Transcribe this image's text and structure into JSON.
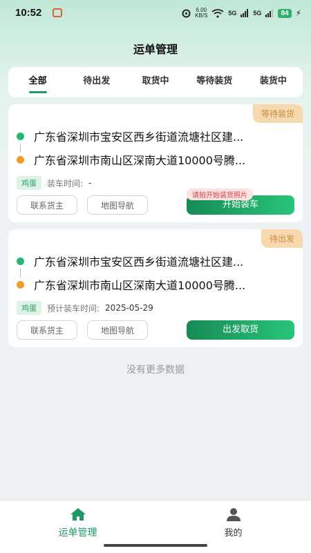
{
  "status_bar": {
    "time": "10:52",
    "speed_value": "6.00",
    "speed_unit": "KB/S",
    "network_1": "5G",
    "network_2": "5G",
    "battery": "84"
  },
  "page_title": "运单管理",
  "tabs": [
    {
      "label": "全部",
      "active": true
    },
    {
      "label": "待出发",
      "active": false
    },
    {
      "label": "取货中",
      "active": false
    },
    {
      "label": "等待装货",
      "active": false
    },
    {
      "label": "装货中",
      "active": false
    }
  ],
  "orders": [
    {
      "status": "等待装货",
      "from": "广东省深圳市宝安区西乡街道流塘社区建...",
      "to": "广东省深圳市南山区深南大道10000号腾...",
      "tag": "鸡蛋",
      "time_label": "装车时间:",
      "time_value": "-",
      "btn_contact": "联系货主",
      "btn_nav": "地图导航",
      "tip": "请拍开始装货照片",
      "btn_primary": "开始装车"
    },
    {
      "status": "待出发",
      "from": "广东省深圳市宝安区西乡街道流塘社区建...",
      "to": "广东省深圳市南山区深南大道10000号腾...",
      "tag": "鸡蛋",
      "time_label": "预计装车时间:",
      "time_value": "2025-05-29",
      "btn_contact": "联系货主",
      "btn_nav": "地图导航",
      "btn_primary": "出发取货"
    }
  ],
  "no_more_text": "没有更多数据",
  "bottom_nav": [
    {
      "label": "运单管理",
      "icon": "home-icon",
      "active": true
    },
    {
      "label": "我的",
      "icon": "person-icon",
      "active": false
    }
  ],
  "colors": {
    "primary": "#1f9a63",
    "badge_bg": "#f7d9b0",
    "badge_text": "#c98a3c",
    "tip_text": "#d34343"
  }
}
